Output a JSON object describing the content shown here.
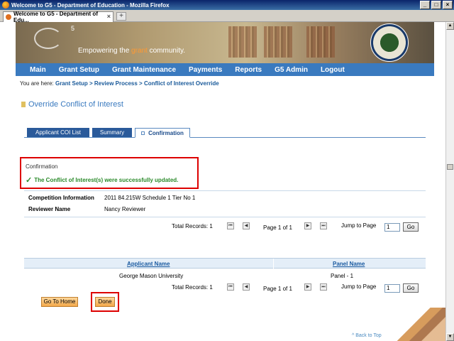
{
  "browser": {
    "title": "Welcome to G5 - Department of Education - Mozilla Firefox",
    "tab_label": "Welcome to G5 - Department of Edu...",
    "new_tab": "+",
    "tab_close": "×",
    "min": "_",
    "max": "□",
    "close": "×"
  },
  "banner": {
    "logo_sup": "5",
    "tagline_pre": "Empowering the ",
    "tagline_highlight": "grant",
    "tagline_post": " community."
  },
  "nav": {
    "items": [
      "Main",
      "Grant Setup",
      "Grant Maintenance",
      "Payments",
      "Reports",
      "G5 Admin",
      "Logout"
    ]
  },
  "breadcrumb": {
    "prefix": "You are here: ",
    "items": [
      "Grant Setup",
      "Review Process",
      "Conflict of Interest Override"
    ],
    "sep": " > "
  },
  "page": {
    "title": "Override Conflict of Interest"
  },
  "tabs": [
    "Applicant COI List",
    "Summary",
    "Confirmation"
  ],
  "confirmation": {
    "label": "Confirmation",
    "check": "✓",
    "message": "The Conflict of Interest(s) were successfully updated."
  },
  "info": {
    "competition_label": "Competition Information",
    "competition_value": "2011 84.215W Schedule 1 Tier No 1",
    "reviewer_label": "Reviewer Name",
    "reviewer_value": "Nancy Reviewer"
  },
  "pager": {
    "total_records": "Total Records: 1",
    "page_of": "Page 1 of 1",
    "jump_label": "Jump to Page",
    "jump_value": "1",
    "go": "Go",
    "first": "⏮",
    "prev": "◀",
    "next": "▶",
    "last": "⏭"
  },
  "table": {
    "columns": [
      "Applicant Name",
      "Panel Name"
    ],
    "rows": [
      [
        "George Mason University",
        "Panel - 1"
      ]
    ]
  },
  "buttons": {
    "go_home": "Go To Home",
    "done": "Done"
  },
  "back_to_top": "^ Back to Top"
}
